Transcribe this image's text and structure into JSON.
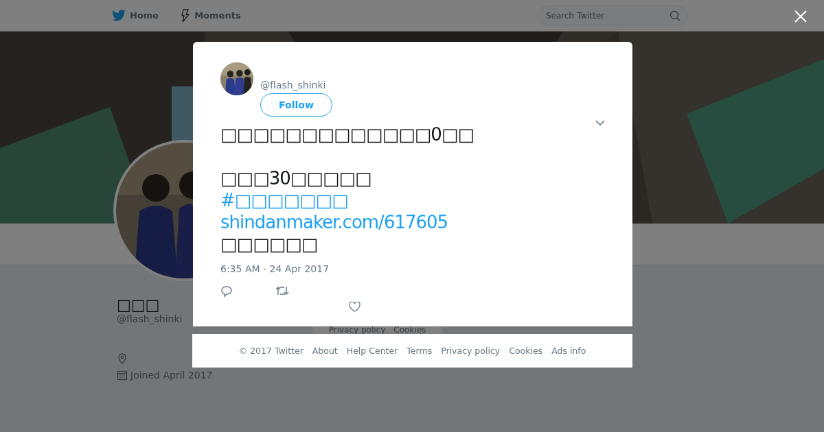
{
  "nav": {
    "items": [
      {
        "label": "Home",
        "kind": "home"
      },
      {
        "label": "Moments",
        "kind": "moments"
      }
    ],
    "search": {
      "placeholder": "Search Twitter"
    }
  },
  "profile": {
    "name": "□□□",
    "handle": "@flash_shinki",
    "joined": "Joined April 2017"
  },
  "background_footer": {
    "links": [
      "Privacy policy",
      "Cookies"
    ]
  },
  "tweet": {
    "handle": "@flash_shinki",
    "follow": "Follow",
    "text_before": "□□□□□□□□□□□□□0□□\n\n□□□30□□□□□",
    "hashtag": "#□□□□□□□",
    "link": "shindanmaker.com/617605",
    "text_after": "□□□□□□",
    "time": "6:35 AM - 24 Apr 2017"
  },
  "footer": {
    "copyright": "© 2017 Twitter",
    "links": [
      "About",
      "Help Center",
      "Terms",
      "Privacy policy",
      "Cookies",
      "Ads info"
    ]
  }
}
